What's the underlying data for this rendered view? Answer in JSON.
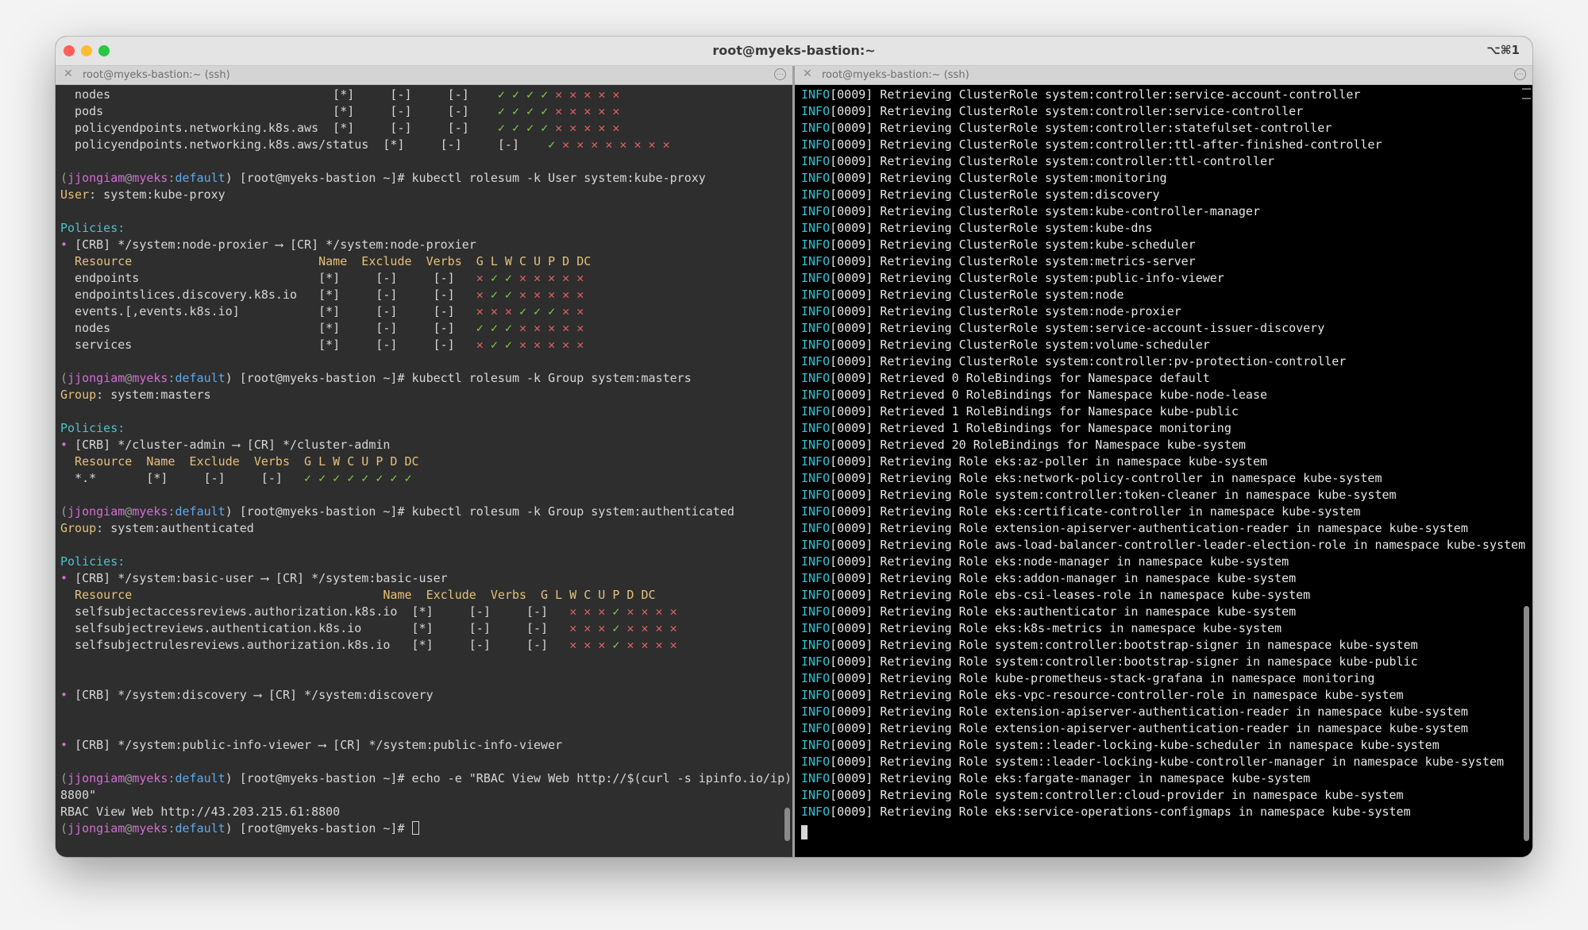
{
  "window": {
    "title": "root@myeks-bastion:~",
    "shortcut": "⌥⌘1"
  },
  "tabs": [
    {
      "close": "✕",
      "title": "root@myeks-bastion:~ (ssh)",
      "menu": "…"
    },
    {
      "close": "✕",
      "title": "root@myeks-bastion:~ (ssh)",
      "menu": "…"
    }
  ],
  "colors": {
    "info": "#33c5d6",
    "prompt_user": "#d26ed2",
    "context": "#e5c07b",
    "check": "#7fd048",
    "cross": "#e06060"
  },
  "left": {
    "lines": [
      [
        {
          "t": "  nodes                               [*]     [-]     [-]    ",
          "c": "white"
        },
        {
          "t": "✓ ✓ ✓ ✓ ",
          "c": "green"
        },
        {
          "t": "✕ ✕ ✕ ✕ ✕",
          "c": "red"
        }
      ],
      [
        {
          "t": "  pods                                [*]     [-]     [-]    ",
          "c": "white"
        },
        {
          "t": "✓ ✓ ✓ ✓ ",
          "c": "green"
        },
        {
          "t": "✕ ✕ ✕ ✕ ✕",
          "c": "red"
        }
      ],
      [
        {
          "t": "  policyendpoints.networking.k8s.aws  [*]     [-]     [-]    ",
          "c": "white"
        },
        {
          "t": "✓ ✓ ✓ ✓ ",
          "c": "green"
        },
        {
          "t": "✕ ✕ ✕ ✕ ✕",
          "c": "red"
        }
      ],
      [
        {
          "t": "  policyendpoints.networking.k8s.aws/status  [*]     [-]     [-]    ",
          "c": "white"
        },
        {
          "t": "✓ ",
          "c": "green"
        },
        {
          "t": "✕ ✕ ✕ ✕ ✕ ✕ ✕ ✕",
          "c": "red"
        }
      ],
      [],
      [
        {
          "t": "(",
          "c": "gray"
        },
        {
          "t": "jjongiam",
          "c": "user"
        },
        {
          "t": "@",
          "c": "gray"
        },
        {
          "t": "myeks",
          "c": "user"
        },
        {
          "t": ":",
          "c": "gray"
        },
        {
          "t": "default",
          "c": "blue"
        },
        {
          "t": ") [root@myeks-bastion ~]# kubectl rolesum -k User system:kube-proxy",
          "c": "white"
        }
      ],
      [
        {
          "t": "User",
          "c": "yellow"
        },
        {
          "t": ": system:kube-proxy",
          "c": "white"
        }
      ],
      [],
      [
        {
          "t": "Policies:",
          "c": "cyan"
        }
      ],
      [
        {
          "t": "• ",
          "c": "mag"
        },
        {
          "t": "[CRB] */system:node-proxier ⟶ [CR] */system:node-proxier",
          "c": "white"
        }
      ],
      [
        {
          "t": "  Resource                          Name  Exclude  Verbs  G L W C U P D DC",
          "c": "yellow"
        }
      ],
      [
        {
          "t": "  endpoints                         [*]     [-]     [-]   ",
          "c": "white"
        },
        {
          "t": "✕ ",
          "c": "red"
        },
        {
          "t": "✓ ✓ ",
          "c": "green"
        },
        {
          "t": "✕ ✕ ✕ ✕ ✕",
          "c": "red"
        }
      ],
      [
        {
          "t": "  endpointslices.discovery.k8s.io   [*]     [-]     [-]   ",
          "c": "white"
        },
        {
          "t": "✕ ",
          "c": "red"
        },
        {
          "t": "✓ ✓ ",
          "c": "green"
        },
        {
          "t": "✕ ✕ ✕ ✕ ✕",
          "c": "red"
        }
      ],
      [
        {
          "t": "  events.[,events.k8s.io]           [*]     [-]     [-]   ",
          "c": "white"
        },
        {
          "t": "✕ ✕ ✕ ",
          "c": "red"
        },
        {
          "t": "✓ ✓ ✓ ",
          "c": "green"
        },
        {
          "t": "✕ ✕",
          "c": "red"
        }
      ],
      [
        {
          "t": "  nodes                             [*]     [-]     [-]   ",
          "c": "white"
        },
        {
          "t": "✓ ✓ ✓ ",
          "c": "green"
        },
        {
          "t": "✕ ✕ ✕ ✕ ✕",
          "c": "red"
        }
      ],
      [
        {
          "t": "  services                          [*]     [-]     [-]   ",
          "c": "white"
        },
        {
          "t": "✕ ",
          "c": "red"
        },
        {
          "t": "✓ ✓ ",
          "c": "green"
        },
        {
          "t": "✕ ✕ ✕ ✕ ✕",
          "c": "red"
        }
      ],
      [],
      [
        {
          "t": "(",
          "c": "gray"
        },
        {
          "t": "jjongiam",
          "c": "user"
        },
        {
          "t": "@",
          "c": "gray"
        },
        {
          "t": "myeks",
          "c": "user"
        },
        {
          "t": ":",
          "c": "gray"
        },
        {
          "t": "default",
          "c": "blue"
        },
        {
          "t": ") [root@myeks-bastion ~]# kubectl rolesum -k Group system:masters",
          "c": "white"
        }
      ],
      [
        {
          "t": "Group",
          "c": "yellow"
        },
        {
          "t": ": system:masters",
          "c": "white"
        }
      ],
      [],
      [
        {
          "t": "Policies:",
          "c": "cyan"
        }
      ],
      [
        {
          "t": "• ",
          "c": "mag"
        },
        {
          "t": "[CRB] */cluster-admin ⟶ [CR] */cluster-admin",
          "c": "white"
        }
      ],
      [
        {
          "t": "  Resource  Name  Exclude  Verbs  G L W C U P D DC",
          "c": "yellow"
        }
      ],
      [
        {
          "t": "  *.*       [*]     [-]     [-]   ",
          "c": "white"
        },
        {
          "t": "✓ ✓ ✓ ✓ ✓ ✓ ✓ ✓",
          "c": "green"
        }
      ],
      [],
      [
        {
          "t": "(",
          "c": "gray"
        },
        {
          "t": "jjongiam",
          "c": "user"
        },
        {
          "t": "@",
          "c": "gray"
        },
        {
          "t": "myeks",
          "c": "user"
        },
        {
          "t": ":",
          "c": "gray"
        },
        {
          "t": "default",
          "c": "blue"
        },
        {
          "t": ") [root@myeks-bastion ~]# kubectl rolesum -k Group system:authenticated",
          "c": "white"
        }
      ],
      [
        {
          "t": "Group",
          "c": "yellow"
        },
        {
          "t": ": system:authenticated",
          "c": "white"
        }
      ],
      [],
      [
        {
          "t": "Policies:",
          "c": "cyan"
        }
      ],
      [
        {
          "t": "• ",
          "c": "mag"
        },
        {
          "t": "[CRB] */system:basic-user ⟶ [CR] */system:basic-user",
          "c": "white"
        }
      ],
      [
        {
          "t": "  Resource                                   Name  Exclude  Verbs  G L W C U P D DC",
          "c": "yellow"
        }
      ],
      [
        {
          "t": "  selfsubjectaccessreviews.authorization.k8s.io  [*]     [-]     [-]   ",
          "c": "white"
        },
        {
          "t": "✕ ✕ ✕ ",
          "c": "red"
        },
        {
          "t": "✓ ",
          "c": "green"
        },
        {
          "t": "✕ ✕ ✕ ✕",
          "c": "red"
        }
      ],
      [
        {
          "t": "  selfsubjectreviews.authentication.k8s.io       [*]     [-]     [-]   ",
          "c": "white"
        },
        {
          "t": "✕ ✕ ✕ ",
          "c": "red"
        },
        {
          "t": "✓ ",
          "c": "green"
        },
        {
          "t": "✕ ✕ ✕ ✕",
          "c": "red"
        }
      ],
      [
        {
          "t": "  selfsubjectrulesreviews.authorization.k8s.io   [*]     [-]     [-]   ",
          "c": "white"
        },
        {
          "t": "✕ ✕ ✕ ",
          "c": "red"
        },
        {
          "t": "✓ ",
          "c": "green"
        },
        {
          "t": "✕ ✕ ✕ ✕",
          "c": "red"
        }
      ],
      [],
      [],
      [
        {
          "t": "• ",
          "c": "mag"
        },
        {
          "t": "[CRB] */system:discovery ⟶ [CR] */system:discovery",
          "c": "white"
        }
      ],
      [],
      [],
      [
        {
          "t": "• ",
          "c": "mag"
        },
        {
          "t": "[CRB] */system:public-info-viewer ⟶ [CR] */system:public-info-viewer",
          "c": "white"
        }
      ],
      [],
      [
        {
          "t": "(",
          "c": "gray"
        },
        {
          "t": "jjongiam",
          "c": "user"
        },
        {
          "t": "@",
          "c": "gray"
        },
        {
          "t": "myeks",
          "c": "user"
        },
        {
          "t": ":",
          "c": "gray"
        },
        {
          "t": "default",
          "c": "blue"
        },
        {
          "t": ") [root@myeks-bastion ~]# echo -e \"RBAC View Web http://$(curl -s ipinfo.io/ip):",
          "c": "white"
        }
      ],
      [
        {
          "t": "8800\"",
          "c": "white"
        }
      ],
      [
        {
          "t": "RBAC View Web http://43.203.215.61:8800",
          "c": "white"
        }
      ],
      [
        {
          "t": "(",
          "c": "gray"
        },
        {
          "t": "jjongiam",
          "c": "user"
        },
        {
          "t": "@",
          "c": "gray"
        },
        {
          "t": "myeks",
          "c": "user"
        },
        {
          "t": ":",
          "c": "gray"
        },
        {
          "t": "default",
          "c": "blue"
        },
        {
          "t": ") [root@myeks-bastion ~]# ",
          "c": "white"
        },
        {
          "t": "",
          "c": "cursor"
        }
      ]
    ]
  },
  "right": {
    "lines": [
      [
        "INFO",
        "[0009] Retrieving ClusterRole system:controller:service-account-controller"
      ],
      [
        "INFO",
        "[0009] Retrieving ClusterRole system:controller:service-controller"
      ],
      [
        "INFO",
        "[0009] Retrieving ClusterRole system:controller:statefulset-controller"
      ],
      [
        "INFO",
        "[0009] Retrieving ClusterRole system:controller:ttl-after-finished-controller"
      ],
      [
        "INFO",
        "[0009] Retrieving ClusterRole system:controller:ttl-controller"
      ],
      [
        "INFO",
        "[0009] Retrieving ClusterRole system:monitoring"
      ],
      [
        "INFO",
        "[0009] Retrieving ClusterRole system:discovery"
      ],
      [
        "INFO",
        "[0009] Retrieving ClusterRole system:kube-controller-manager"
      ],
      [
        "INFO",
        "[0009] Retrieving ClusterRole system:kube-dns"
      ],
      [
        "INFO",
        "[0009] Retrieving ClusterRole system:kube-scheduler"
      ],
      [
        "INFO",
        "[0009] Retrieving ClusterRole system:metrics-server"
      ],
      [
        "INFO",
        "[0009] Retrieving ClusterRole system:public-info-viewer"
      ],
      [
        "INFO",
        "[0009] Retrieving ClusterRole system:node"
      ],
      [
        "INFO",
        "[0009] Retrieving ClusterRole system:node-proxier"
      ],
      [
        "INFO",
        "[0009] Retrieving ClusterRole system:service-account-issuer-discovery"
      ],
      [
        "INFO",
        "[0009] Retrieving ClusterRole system:volume-scheduler"
      ],
      [
        "INFO",
        "[0009] Retrieving ClusterRole system:controller:pv-protection-controller"
      ],
      [
        "INFO",
        "[0009] Retrieved 0 RoleBindings for Namespace default"
      ],
      [
        "INFO",
        "[0009] Retrieved 0 RoleBindings for Namespace kube-node-lease"
      ],
      [
        "INFO",
        "[0009] Retrieved 1 RoleBindings for Namespace kube-public"
      ],
      [
        "INFO",
        "[0009] Retrieved 1 RoleBindings for Namespace monitoring"
      ],
      [
        "INFO",
        "[0009] Retrieved 20 RoleBindings for Namespace kube-system"
      ],
      [
        "INFO",
        "[0009] Retrieving Role eks:az-poller in namespace kube-system"
      ],
      [
        "INFO",
        "[0009] Retrieving Role eks:network-policy-controller in namespace kube-system"
      ],
      [
        "INFO",
        "[0009] Retrieving Role system:controller:token-cleaner in namespace kube-system"
      ],
      [
        "INFO",
        "[0009] Retrieving Role eks:certificate-controller in namespace kube-system"
      ],
      [
        "INFO",
        "[0009] Retrieving Role extension-apiserver-authentication-reader in namespace kube-system"
      ],
      [
        "INFO",
        "[0009] Retrieving Role aws-load-balancer-controller-leader-election-role in namespace kube-system"
      ],
      [
        "INFO",
        "[0009] Retrieving Role eks:node-manager in namespace kube-system"
      ],
      [
        "INFO",
        "[0009] Retrieving Role eks:addon-manager in namespace kube-system"
      ],
      [
        "INFO",
        "[0009] Retrieving Role ebs-csi-leases-role in namespace kube-system"
      ],
      [
        "INFO",
        "[0009] Retrieving Role eks:authenticator in namespace kube-system"
      ],
      [
        "INFO",
        "[0009] Retrieving Role eks:k8s-metrics in namespace kube-system"
      ],
      [
        "INFO",
        "[0009] Retrieving Role system:controller:bootstrap-signer in namespace kube-system"
      ],
      [
        "INFO",
        "[0009] Retrieving Role system:controller:bootstrap-signer in namespace kube-public"
      ],
      [
        "INFO",
        "[0009] Retrieving Role kube-prometheus-stack-grafana in namespace monitoring"
      ],
      [
        "INFO",
        "[0009] Retrieving Role eks-vpc-resource-controller-role in namespace kube-system"
      ],
      [
        "INFO",
        "[0009] Retrieving Role extension-apiserver-authentication-reader in namespace kube-system"
      ],
      [
        "INFO",
        "[0009] Retrieving Role extension-apiserver-authentication-reader in namespace kube-system"
      ],
      [
        "INFO",
        "[0009] Retrieving Role system::leader-locking-kube-scheduler in namespace kube-system"
      ],
      [
        "INFO",
        "[0009] Retrieving Role system::leader-locking-kube-controller-manager in namespace kube-system"
      ],
      [
        "INFO",
        "[0009] Retrieving Role eks:fargate-manager in namespace kube-system"
      ],
      [
        "INFO",
        "[0009] Retrieving Role system:controller:cloud-provider in namespace kube-system"
      ],
      [
        "INFO",
        "[0009] Retrieving Role eks:service-operations-configmaps in namespace kube-system"
      ]
    ]
  }
}
